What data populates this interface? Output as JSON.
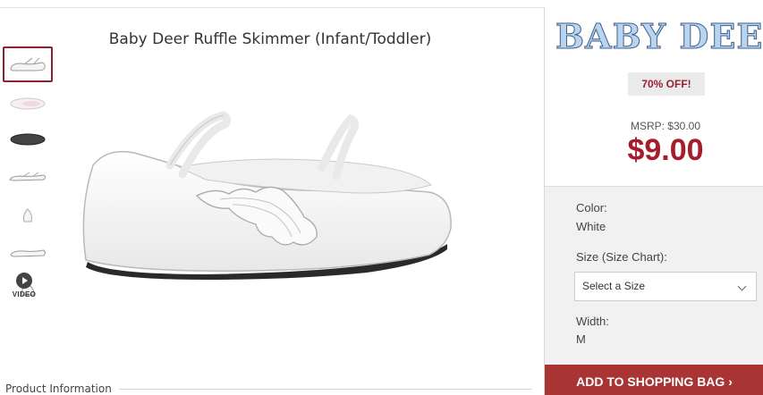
{
  "product": {
    "title": "Baby Deer Ruffle Skimmer (Infant/Toddler)",
    "video_label": "VIDEO",
    "info_label": "Product Information"
  },
  "brand": {
    "name": "BABY DEER"
  },
  "pricing": {
    "discount": "70% OFF!",
    "msrp": "MSRP: $30.00",
    "price": "$9.00"
  },
  "options": {
    "color_label": "Color:",
    "color_value": "White",
    "size_label": "Size (Size Chart):",
    "size_placeholder": "Select a Size",
    "width_label": "Width:",
    "width_value": "M"
  },
  "cta": {
    "add_to_bag": "ADD TO SHOPPING BAG ›"
  },
  "colors": {
    "accent": "#a71c2b",
    "button": "#a83434",
    "thumb_border": "#8b2332"
  }
}
